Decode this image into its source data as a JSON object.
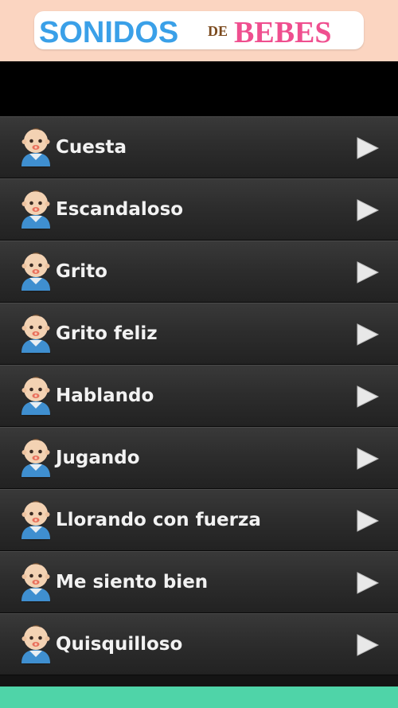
{
  "header": {
    "logo_word_1": "SONIDOS",
    "logo_word_2": "DE",
    "logo_word_3": "BEBES",
    "background_color": "#fbd5c1",
    "logo_colors": {
      "sonidos": "#3aa0e8",
      "de": "#7b4a1e",
      "bebes": "#ef4f8f"
    }
  },
  "list": {
    "items": [
      {
        "label": "Cuesta",
        "avatar_icon": "baby-icon",
        "action_icon": "play-icon"
      },
      {
        "label": "Escandaloso",
        "avatar_icon": "baby-icon",
        "action_icon": "play-icon"
      },
      {
        "label": "Grito",
        "avatar_icon": "baby-icon",
        "action_icon": "play-icon"
      },
      {
        "label": "Grito feliz",
        "avatar_icon": "baby-icon",
        "action_icon": "play-icon"
      },
      {
        "label": "Hablando",
        "avatar_icon": "baby-icon",
        "action_icon": "play-icon"
      },
      {
        "label": "Jugando",
        "avatar_icon": "baby-icon",
        "action_icon": "play-icon"
      },
      {
        "label": "Llorando con fuerza",
        "avatar_icon": "baby-icon",
        "action_icon": "play-icon"
      },
      {
        "label": "Me siento bien",
        "avatar_icon": "baby-icon",
        "action_icon": "play-icon"
      },
      {
        "label": "Quisquilloso",
        "avatar_icon": "baby-icon",
        "action_icon": "play-icon"
      }
    ]
  },
  "footer": {
    "bar_color": "#4fd4a8"
  }
}
